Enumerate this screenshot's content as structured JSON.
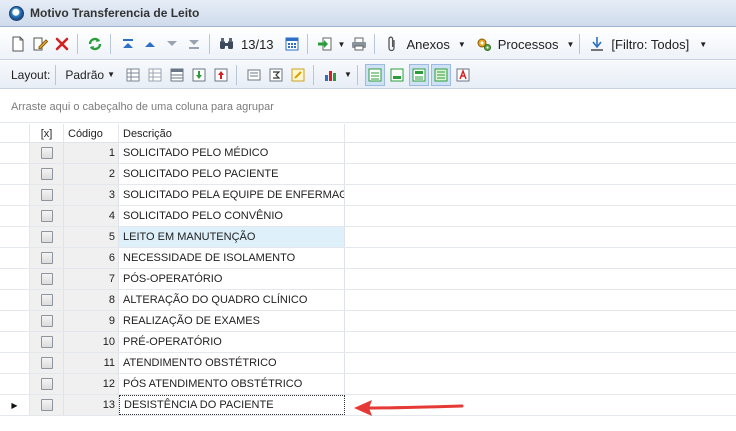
{
  "window": {
    "title": "Motivo Transferencia de Leito"
  },
  "toolbar": {
    "record_counter": "13/13",
    "anexos_label": "Anexos",
    "processos_label": "Processos",
    "filter_label": "[Filtro: Todos]"
  },
  "layout_bar": {
    "layout_label": "Layout:",
    "padrao_label": "Padrão"
  },
  "group_panel": {
    "hint": "Arraste aqui o cabeçalho de uma coluna para agrupar"
  },
  "grid": {
    "columns": {
      "check": "[x]",
      "code": "Código",
      "description": "Descrição"
    },
    "rows": [
      {
        "code": "1",
        "description": "SOLICITADO PELO MÉDICO"
      },
      {
        "code": "2",
        "description": "SOLICITADO PELO PACIENTE"
      },
      {
        "code": "3",
        "description": "SOLICITADO PELA EQUIPE DE ENFERMAGEM"
      },
      {
        "code": "4",
        "description": "SOLICITADO PELO CONVÊNIO"
      },
      {
        "code": "5",
        "description": "LEITO EM MANUTENÇÃO"
      },
      {
        "code": "6",
        "description": "NECESSIDADE DE ISOLAMENTO"
      },
      {
        "code": "7",
        "description": "PÓS-OPERATÓRIO"
      },
      {
        "code": "8",
        "description": "ALTERAÇÃO DO QUADRO CLÍNICO"
      },
      {
        "code": "9",
        "description": "REALIZAÇÃO DE EXAMES"
      },
      {
        "code": "10",
        "description": "PRÉ-OPERATÓRIO"
      },
      {
        "code": "11",
        "description": "ATENDIMENTO OBSTÉTRICO"
      },
      {
        "code": "12",
        "description": "PÓS ATENDIMENTO OBSTÉTRICO"
      },
      {
        "code": "13",
        "description": "DESISTÊNCIA DO PACIENTE"
      }
    ]
  },
  "colors": {
    "hover_row": "#def0fa",
    "annotation_arrow": "#e53935",
    "delete_icon": "#d42020",
    "accent_blue": "#2d6fc4"
  },
  "icons": {
    "toolbar": [
      "new-document-icon",
      "edit-icon",
      "delete-icon",
      "refresh-icon",
      "first-record-icon",
      "previous-record-icon",
      "next-record-icon",
      "last-record-icon",
      "find-icon",
      "calendar-icon",
      "export-icon",
      "print-icon",
      "paperclip-icon",
      "processes-icon",
      "filter-icon"
    ],
    "layout": [
      "layout-save-icon",
      "layout-load-icon",
      "grid-config-icon",
      "import-icon",
      "export-red-icon",
      "columns-icon",
      "sum-icon",
      "highlight-icon",
      "chart-icon",
      "view-grid-icon",
      "view-green-icon",
      "view-list-icon",
      "view-card-icon",
      "font-icon"
    ]
  }
}
